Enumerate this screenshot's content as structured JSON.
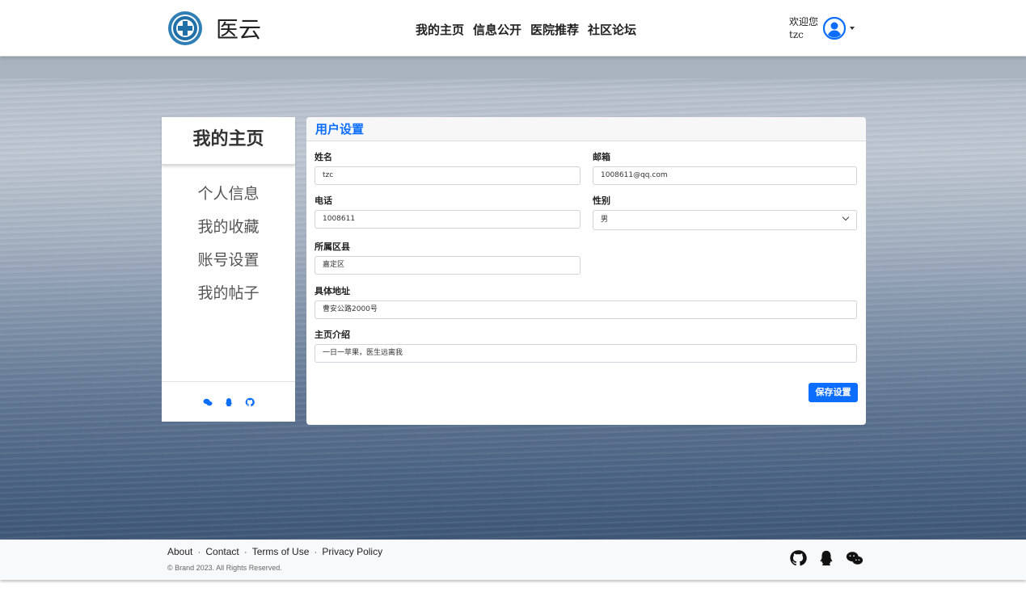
{
  "header": {
    "brand": "医云",
    "nav": [
      "我的主页",
      "信息公开",
      "医院推荐",
      "社区论坛"
    ],
    "welcome_line1": "欢迎您",
    "welcome_line2": "tzc"
  },
  "sidebar": {
    "title": "我的主页",
    "items": [
      "个人信息",
      "我的收藏",
      "账号设置",
      "我的帖子"
    ],
    "footer_icons": [
      "wechat-icon",
      "qq-icon",
      "github-icon"
    ]
  },
  "panel": {
    "title": "用户设置",
    "fields": {
      "name": {
        "label": "姓名",
        "value": "tzc"
      },
      "email": {
        "label": "邮箱",
        "value": "1008611@qq.com"
      },
      "phone": {
        "label": "电话",
        "value": "1008611"
      },
      "gender": {
        "label": "性别",
        "value": "男"
      },
      "district": {
        "label": "所属区县",
        "value": "嘉定区"
      },
      "address": {
        "label": "具体地址",
        "value": "曹安公路2000号"
      },
      "intro": {
        "label": "主页介绍",
        "value": "一日一苹果，医生远离我"
      }
    },
    "save_label": "保存设置"
  },
  "footer": {
    "links": [
      "About",
      "Contact",
      "Terms of Use",
      "Privacy Policy"
    ],
    "separator": "·",
    "copyright": "© Brand 2023. All Rights Reserved.",
    "icons": [
      "github-icon",
      "qq-icon",
      "wechat-icon"
    ]
  },
  "colors": {
    "accent": "#0d6efd"
  }
}
